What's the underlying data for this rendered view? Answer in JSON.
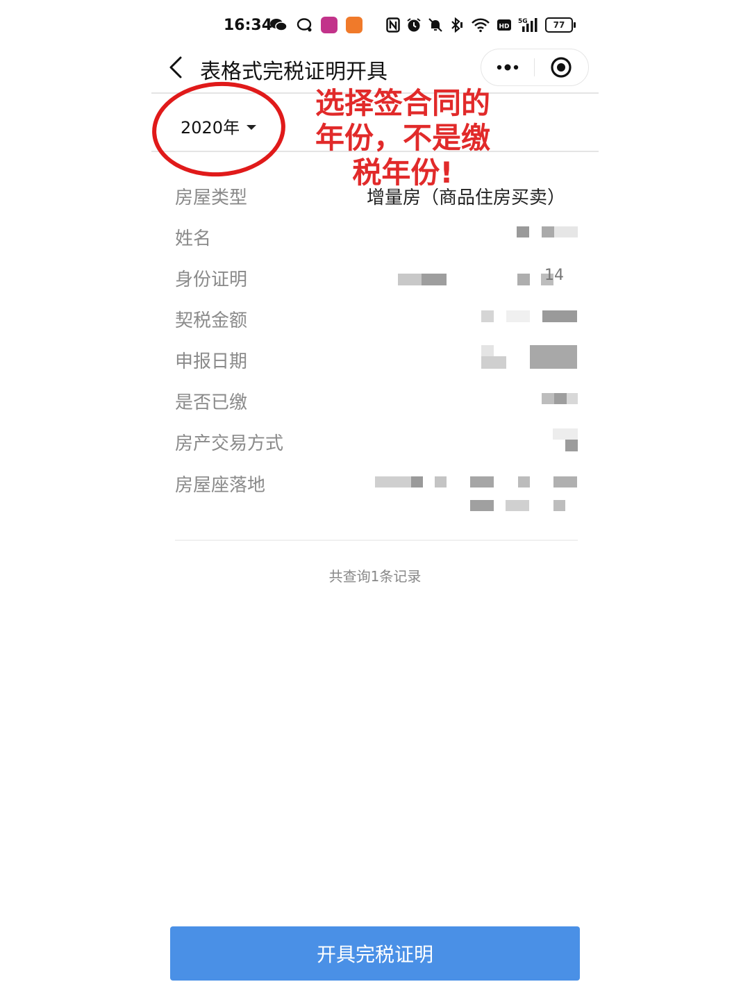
{
  "status_bar": {
    "time": "16:34",
    "battery": "77",
    "network": "5G",
    "icons_left": [
      "wechat-icon",
      "chat-bubble-icon",
      "app-badge-purple",
      "app-badge-orange"
    ],
    "icons_right": [
      "nfc-icon",
      "alarm-icon",
      "mute-icon",
      "bluetooth-icon",
      "wifi-icon",
      "hd-icon",
      "signal-icon",
      "battery-icon"
    ],
    "colors": {
      "badge_purple": "#c2338a",
      "badge_orange": "#f07a2a"
    }
  },
  "header": {
    "title": "表格式完税证明开具",
    "more_icon": "more-dots-icon",
    "close_icon": "target-close-icon"
  },
  "filter": {
    "year": "2020年"
  },
  "annotation": {
    "note": "选择签合同的年份，不是缴税年份!",
    "color": "#e01a1a"
  },
  "record": {
    "house_type": {
      "label": "房屋类型",
      "value": "增量房（商品住房买卖）"
    },
    "name": {
      "label": "姓名"
    },
    "id_doc": {
      "label": "身份证明",
      "visible_suffix": "14"
    },
    "deed_tax": {
      "label": "契税金额"
    },
    "declare_date": {
      "label": "申报日期"
    },
    "is_paid": {
      "label": "是否已缴"
    },
    "trade_mode": {
      "label": "房产交易方式"
    },
    "location": {
      "label": "房屋座落地"
    }
  },
  "summary": {
    "count_text": "共查询1条记录"
  },
  "actions": {
    "issue_button": "开具完税证明",
    "button_color": "#4a90e6"
  }
}
